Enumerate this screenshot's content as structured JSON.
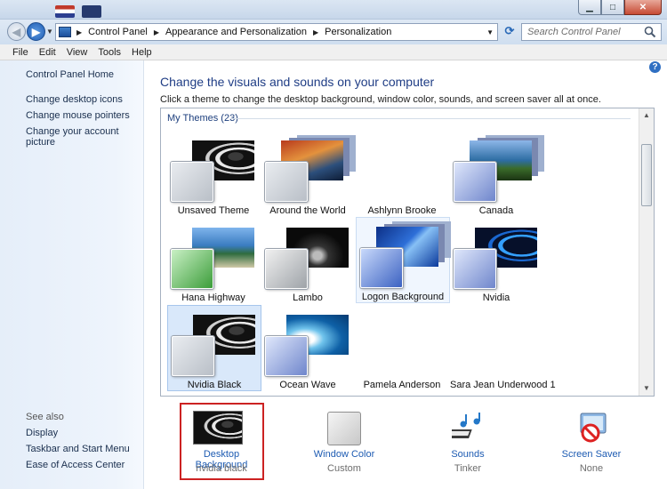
{
  "window": {
    "controls": {
      "minimize": "▁",
      "maximize": "□",
      "close": "✕"
    }
  },
  "address": {
    "crumbs": [
      "Control Panel",
      "Appearance and Personalization",
      "Personalization"
    ],
    "search_placeholder": "Search Control Panel"
  },
  "menu": [
    "File",
    "Edit",
    "View",
    "Tools",
    "Help"
  ],
  "sidebar": {
    "home": "Control Panel Home",
    "links": [
      "Change desktop icons",
      "Change mouse pointers",
      "Change your account picture"
    ],
    "see_also_label": "See also",
    "see_also": [
      "Display",
      "Taskbar and Start Menu",
      "Ease of Access Center"
    ]
  },
  "main": {
    "title": "Change the visuals and sounds on your computer",
    "subtitle": "Click a theme to change the desktop background, window color, sounds, and screen saver all at once.",
    "group": "My Themes (23)",
    "themes": [
      "Unsaved Theme",
      "Around the World",
      "Ashlynn Brooke",
      "Canada",
      "Hana Highway",
      "Lambo",
      "Logon Background",
      "Nvidia",
      "Nvidia Black",
      "Ocean Wave",
      "Pamela Anderson",
      "Sara Jean Underwood 1"
    ],
    "selected_theme": "Nvidia Black"
  },
  "bottom": [
    {
      "label": "Desktop Background",
      "value": "nvidia black"
    },
    {
      "label": "Window Color",
      "value": "Custom"
    },
    {
      "label": "Sounds",
      "value": "Tinker"
    },
    {
      "label": "Screen Saver",
      "value": "None"
    }
  ],
  "colors": {
    "link": "#1d5bb2",
    "title": "#1f3d85",
    "highlight": "#cc2222"
  }
}
